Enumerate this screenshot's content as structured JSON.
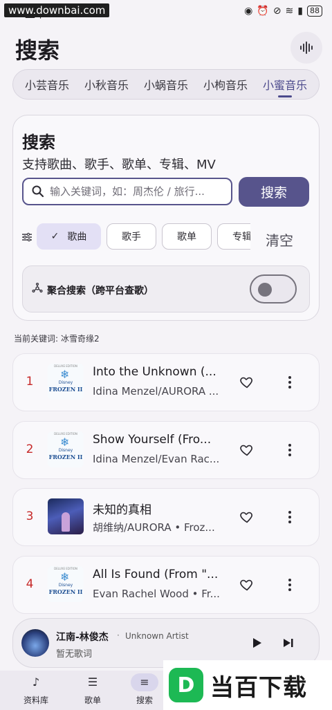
{
  "watermark": "www.downbai.com",
  "status": {
    "time": "上午10:28",
    "battery": "88"
  },
  "header": {
    "title": "搜索"
  },
  "source_tabs": [
    "小芸音乐",
    "小秋音乐",
    "小蜗音乐",
    "小枸音乐",
    "小蜜音乐"
  ],
  "active_tab": "小蜜音乐",
  "search_card": {
    "title": "搜索",
    "subtitle": "支持歌曲、歌手、歌单、专辑、MV",
    "placeholder": "输入关键词，如：周杰伦 / 旅行...",
    "search_button": "搜索",
    "chips": [
      "歌曲",
      "歌手",
      "歌单",
      "专辑"
    ],
    "selected_chip": "歌曲",
    "clear_button": "清空",
    "aggregate_label": "聚合搜索（跨平台查歌）",
    "aggregate_enabled": false
  },
  "keyword": {
    "label": "当前关键词:",
    "value": "冰雪奇缘2"
  },
  "results": [
    {
      "index": "1",
      "title": "Into the Unknown (...",
      "artist": "Idina Menzel/AURORA ..."
    },
    {
      "index": "2",
      "title": "Show Yourself (Fro...",
      "artist": "Idina Menzel/Evan Rac..."
    },
    {
      "index": "3",
      "title": "未知的真相",
      "artist": "胡维纳/AURORA • Froz..."
    },
    {
      "index": "4",
      "title": "All Is Found (From \"...",
      "artist": "Evan Rachel Wood • Fr..."
    }
  ],
  "cover_text": {
    "deluxe": "DELUXE EDITION",
    "disney": "Disney",
    "frozen": "FROZEN II"
  },
  "player": {
    "song": "江南-林俊杰",
    "dot": "·",
    "artist": "Unknown Artist",
    "lyric": "暂无歌词"
  },
  "nav": [
    "资料库",
    "歌单",
    "搜索"
  ],
  "brand": {
    "logo_letter": "D",
    "text": "当百下载"
  },
  "colors": {
    "accent": "#57548c",
    "rank": "#c62828"
  }
}
